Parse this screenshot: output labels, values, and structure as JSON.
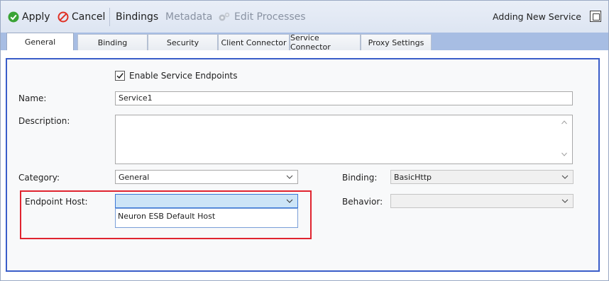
{
  "toolbar": {
    "apply_label": "Apply",
    "cancel_label": "Cancel",
    "bindings_label": "Bindings",
    "metadata_label": "Metadata",
    "edit_processes_label": "Edit Processes",
    "status_text": "Adding New Service"
  },
  "tabs": [
    {
      "label": "General"
    },
    {
      "label": "Binding"
    },
    {
      "label": "Security"
    },
    {
      "label": "Client Connector"
    },
    {
      "label": "Service Connector"
    },
    {
      "label": "Proxy Settings"
    }
  ],
  "form": {
    "enable_endpoints_label": "Enable Service Endpoints",
    "enable_endpoints_checked": true,
    "name_label": "Name:",
    "name_value": "Service1",
    "description_label": "Description:",
    "description_value": "",
    "category_label": "Category:",
    "category_value": "General",
    "binding_label": "Binding:",
    "binding_value": "BasicHttp",
    "endpoint_host_label": "Endpoint Host:",
    "endpoint_host_value": "",
    "endpoint_host_options": [
      "Neuron ESB Default Host"
    ],
    "behavior_label": "Behavior:",
    "behavior_value": ""
  },
  "colors": {
    "accent_border": "#3a5dc9",
    "highlight_box": "#e0242f",
    "tab_strip": "#a7bde3"
  }
}
